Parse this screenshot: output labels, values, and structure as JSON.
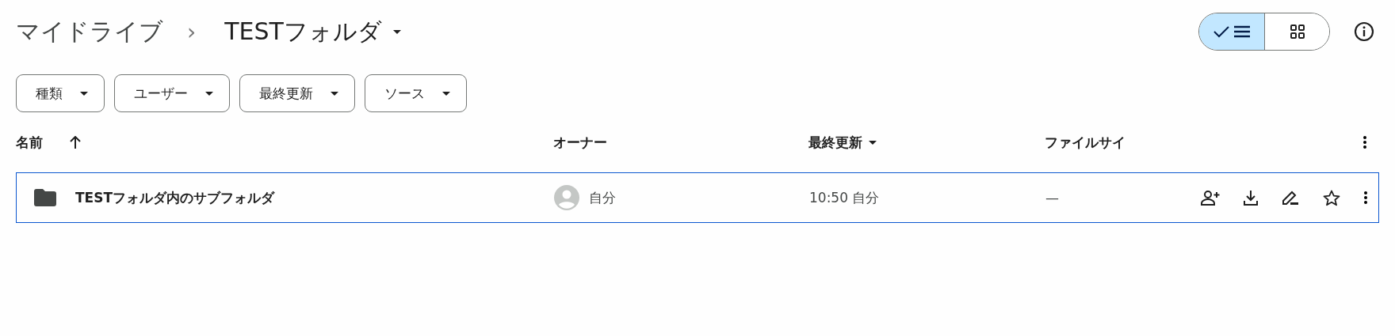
{
  "breadcrumb": {
    "root": "マイドライブ",
    "separator": "›",
    "current": "TESTフォルダ"
  },
  "view_toggle": [
    {
      "kind": "list",
      "selected": true
    },
    {
      "kind": "grid",
      "selected": false
    }
  ],
  "filters": [
    "種類",
    "ユーザー",
    "最終更新",
    "ソース"
  ],
  "table": {
    "columns": [
      {
        "label": "名前",
        "kind": "ascending"
      },
      {
        "label": "オーナー",
        "kind": "plain"
      },
      {
        "label": "最終更新",
        "kind": "descending"
      },
      {
        "label": "ファイルサイ",
        "kind": "plain"
      }
    ],
    "rows": [
      {
        "name": "TESTフォルダ内のサブフォルダ",
        "owner": "自分",
        "modified": "10:50 自分",
        "size": "—",
        "selected": true
      }
    ]
  }
}
